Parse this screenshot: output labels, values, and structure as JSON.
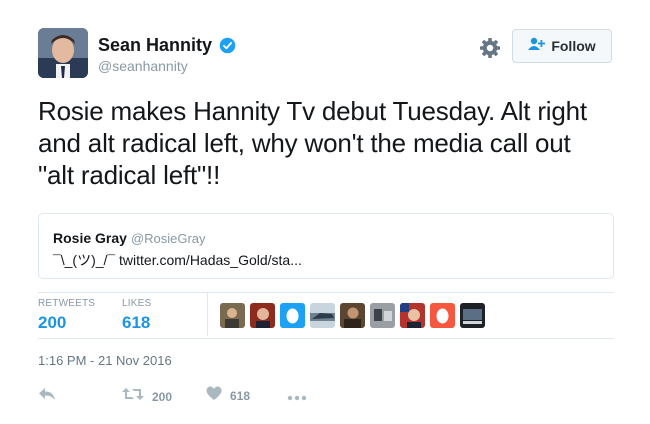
{
  "author": {
    "display_name": "Sean Hannity",
    "handle": "@seanhannity",
    "verified": true,
    "avatar_icon": "profile-photo"
  },
  "follow_button": {
    "label": "Follow",
    "icon": "add-user-icon"
  },
  "settings_icon": "gear-icon",
  "tweet": {
    "text_lines": [
      "Rosie makes Hannity Tv debut Tuesday. Alt right",
      "and alt radical left, why won't the media call out",
      "\"alt radical left\"!!"
    ]
  },
  "quoted_tweet": {
    "name": "Rosie Gray",
    "handle": "@RosieGray",
    "text": "¯\\_(ツ)_/¯ twitter.com/Hadas_Gold/sta..."
  },
  "stats": {
    "retweets_label": "RETWEETS",
    "retweets_count": "200",
    "likes_label": "LIKES",
    "likes_count": "618"
  },
  "likers": [
    "liker-1",
    "liker-2",
    "liker-3",
    "liker-4",
    "liker-5",
    "liker-6",
    "liker-7",
    "liker-8",
    "liker-9"
  ],
  "timestamp": "1:16 PM - 21 Nov 2016",
  "actions": {
    "reply_icon": "reply-icon",
    "retweet_icon": "retweet-icon",
    "retweet_count": "200",
    "like_icon": "heart-icon",
    "like_count": "618",
    "more_icon": "more-icon"
  },
  "colors": {
    "verified_blue": "#1da1f2",
    "link_blue": "#1b95e0",
    "muted": "#8899a6",
    "orange_avatar": "#f5573f",
    "blue_avatar": "#1da1f2"
  }
}
